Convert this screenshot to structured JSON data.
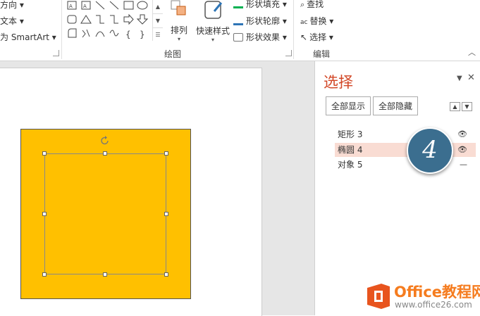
{
  "ribbon": {
    "left_items": [
      "方向",
      "文本",
      "为 SmartArt"
    ],
    "arrange_label": "排列",
    "quick_styles_label": "快速样式",
    "shape_fill": "形状填充",
    "shape_outline": "形状轮廓",
    "shape_effects": "形状效果",
    "drawing_group": "绘图",
    "find": "查找",
    "replace": "替换",
    "select": "选择",
    "editing_group": "编辑",
    "fill_color": "#00B050",
    "outline_color": "#2E75B6"
  },
  "selection_pane": {
    "title": "选择",
    "show_all": "全部显示",
    "hide_all": "全部隐藏",
    "items": [
      {
        "label": "矩形 3",
        "visible": true
      },
      {
        "label": "椭圆 4",
        "visible": true,
        "selected": true
      },
      {
        "label": "对象 5",
        "visible": false
      }
    ]
  },
  "slide": {
    "rect_color": "#FFC000"
  },
  "badge": {
    "number": "4"
  },
  "watermark": {
    "brand": "Office教程网",
    "url": "www.office26.com"
  }
}
